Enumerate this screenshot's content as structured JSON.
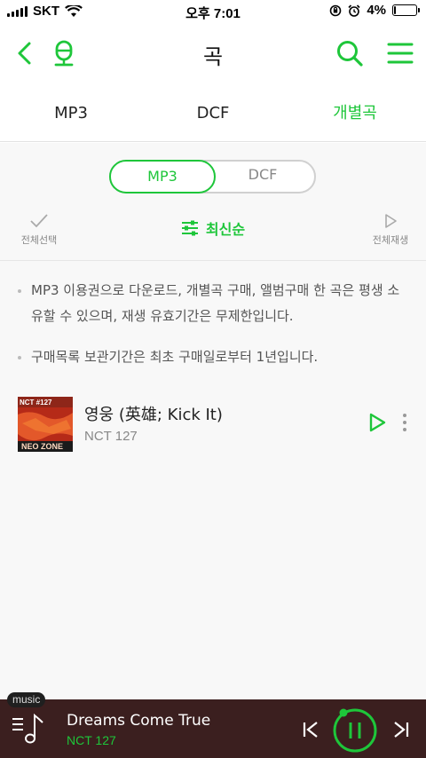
{
  "status": {
    "carrier": "SKT",
    "time": "오후 7:01",
    "battery": "4%",
    "battery_level": 0.04
  },
  "header": {
    "title": "곡",
    "back_icon": "chevron-left-icon",
    "mic_icon": "microphone-icon",
    "search_icon": "search-icon",
    "menu_icon": "hamburger-menu-icon"
  },
  "tabs": [
    {
      "label": "MP3",
      "active": false
    },
    {
      "label": "DCF",
      "active": false
    },
    {
      "label": "개별곡",
      "active": true
    }
  ],
  "segment": {
    "options": [
      "MP3",
      "DCF"
    ],
    "selected": "MP3"
  },
  "toolbar": {
    "select_all": "전체선택",
    "sort": "최신순",
    "play_all": "전체재생"
  },
  "notices": [
    "MP3 이용권으로 다운로드, 개별곡 구매, 앨범구매 한 곡은 평생 소유할 수 있으며, 재생 유효기간은 무제한입니다.",
    "구매목록 보관기간은 최초 구매일로부터 1년입니다."
  ],
  "tracks": [
    {
      "title": "영웅 (英雄; Kick It)",
      "artist": "NCT 127",
      "cover_top": "NCT #127",
      "cover_bottom": "NEO ZONE"
    }
  ],
  "player": {
    "tag": "music",
    "title": "Dreams Come True",
    "artist": "NCT 127"
  },
  "colors": {
    "accent": "#1ec63a",
    "player_bg": "#3b1f1f",
    "cover": "#c7301e"
  }
}
